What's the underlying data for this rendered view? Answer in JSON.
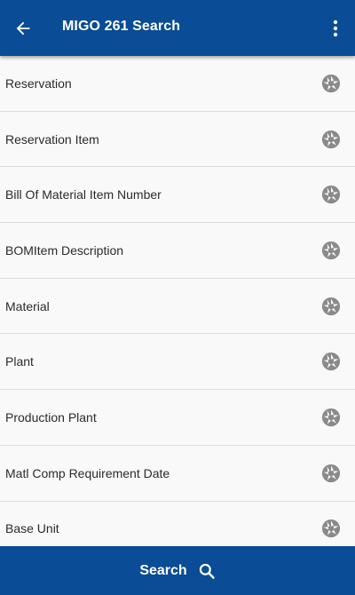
{
  "header": {
    "title": "MIGO 261 Search",
    "back_icon": "arrow-left-icon",
    "menu_icon": "more-vertical-icon"
  },
  "list": {
    "items": [
      {
        "label": "Reservation",
        "icon": "camera-shutter-icon"
      },
      {
        "label": "Reservation Item",
        "icon": "camera-shutter-icon"
      },
      {
        "label": "Bill Of Material Item Number",
        "icon": "camera-shutter-icon"
      },
      {
        "label": "BOMItem Description",
        "icon": "camera-shutter-icon"
      },
      {
        "label": "Material",
        "icon": "camera-shutter-icon"
      },
      {
        "label": "Plant",
        "icon": "camera-shutter-icon"
      },
      {
        "label": "Production Plant",
        "icon": "camera-shutter-icon"
      },
      {
        "label": "Matl Comp Requirement Date",
        "icon": "camera-shutter-icon"
      },
      {
        "label": "Base Unit",
        "icon": "camera-shutter-icon"
      }
    ]
  },
  "footer": {
    "search_label": "Search",
    "search_icon": "search-icon"
  },
  "colors": {
    "brand": "#0a4c95",
    "text": "#2b2b2b",
    "icon": "#8a8a8a",
    "background": "#f9f9f9"
  }
}
